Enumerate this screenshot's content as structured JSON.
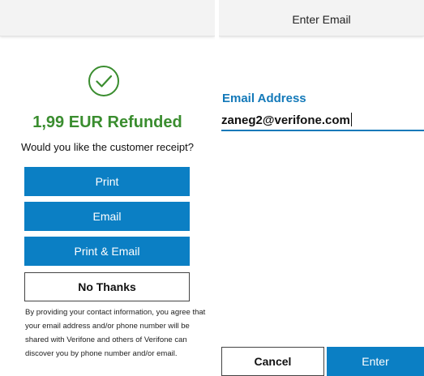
{
  "left_screen": {
    "status_icon": "check-circle-icon",
    "refund_title": "1,99 EUR Refunded",
    "question": "Would you like the customer receipt?",
    "buttons": {
      "print": "Print",
      "email": "Email",
      "print_email": "Print & Email",
      "no_thanks": "No Thanks"
    },
    "disclaimer": "By providing your contact information, you agree that your email address and/or phone number will be shared with Verifone and others of Verifone can discover you by phone number and/or email."
  },
  "right_screen": {
    "title": "Enter Email",
    "field_label": "Email Address",
    "email_value": "zaneg2@verifone.com",
    "buttons": {
      "cancel": "Cancel",
      "enter": "Enter"
    }
  },
  "colors": {
    "accent_blue": "#0b7fc4",
    "label_blue": "#1379b9",
    "success_green": "#3a8d2f"
  }
}
